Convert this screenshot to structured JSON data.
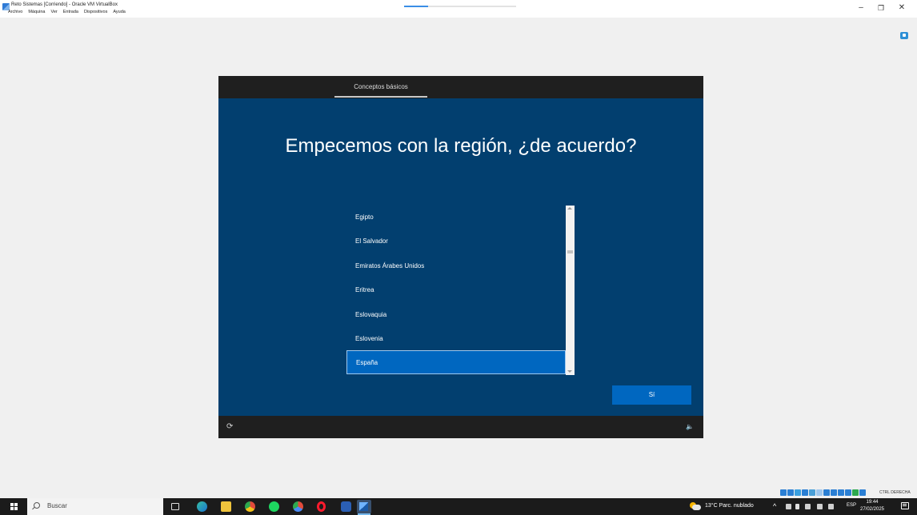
{
  "window": {
    "title": "Reto Sistemas [Corriendo] - Oracle VM VirtualBox",
    "menu": [
      "Archivo",
      "Máquina",
      "Ver",
      "Entrada",
      "Dispositivos",
      "Ayuda"
    ],
    "controls": {
      "minimize": "–",
      "maximize": "❐",
      "close": "✕"
    }
  },
  "oobe": {
    "tab": "Conceptos básicos",
    "heading": "Empecemos con la región, ¿de acuerdo?",
    "regions": [
      "Egipto",
      "El Salvador",
      "Emiratos Árabes Unidos",
      "Eritrea",
      "Eslovaquia",
      "Eslovenia",
      "España"
    ],
    "selected_region": "España",
    "yes_button": "Sí",
    "ease_icon": "⟳",
    "volume_icon": "🔈"
  },
  "vbox_status": {
    "host_key": "CTRL DERECHA",
    "icon_colors": [
      "#2a7fd4",
      "#2a7fd4",
      "#3aa0e0",
      "#2a7fd4",
      "#4aa0d8",
      "#9ec7ee",
      "#2a7fd4",
      "#2a7fd4",
      "#2a7fd4",
      "#2a7fd4",
      "#2da94f",
      "#2a7fd4"
    ]
  },
  "taskbar": {
    "search_placeholder": "Buscar",
    "weather": "13°C  Parc. nublado",
    "tray_chevron": "^",
    "language": "ESP",
    "time": "19:44",
    "date": "27/02/2025"
  },
  "colors": {
    "oobe_blue": "#023f6f",
    "accent": "#0067c0",
    "oobe_bar": "#1f1f1f"
  }
}
